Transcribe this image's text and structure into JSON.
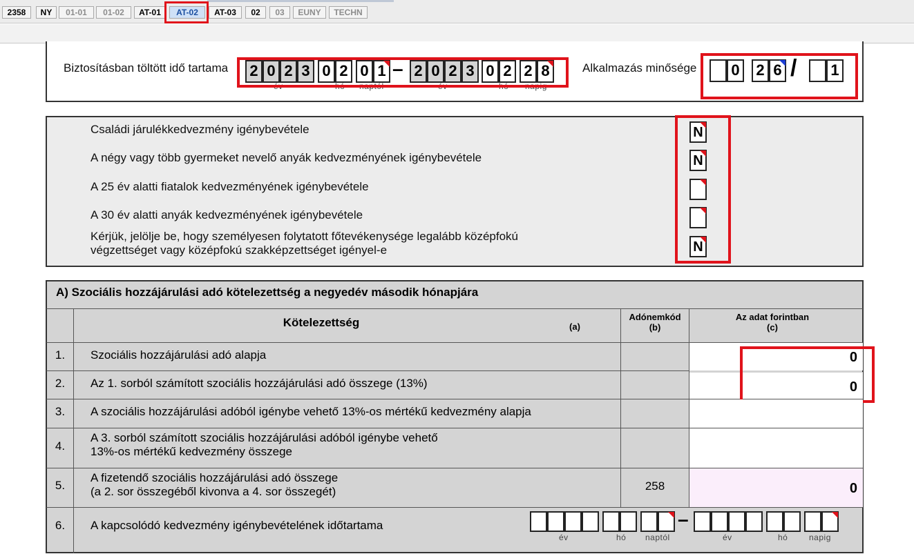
{
  "tabs": [
    {
      "label": "2358",
      "state": "normal"
    },
    {
      "label": "NY",
      "state": "normal"
    },
    {
      "label": "01-01",
      "state": "dim"
    },
    {
      "label": "01-02",
      "state": "dim"
    },
    {
      "label": "AT-01",
      "state": "normal"
    },
    {
      "label": "AT-02",
      "state": "active"
    },
    {
      "label": "AT-03",
      "state": "normal"
    },
    {
      "label": "02",
      "state": "normal"
    },
    {
      "label": "03",
      "state": "dim"
    },
    {
      "label": "EUNY",
      "state": "dim"
    },
    {
      "label": "TECHN",
      "state": "dim"
    }
  ],
  "insurance_period": {
    "label": "Biztosításban töltött idő tartama",
    "from": {
      "year": [
        "2",
        "0",
        "2",
        "3"
      ],
      "month": [
        "0",
        "2"
      ],
      "day": [
        "0",
        "1"
      ]
    },
    "to": {
      "year": [
        "2",
        "0",
        "2",
        "3"
      ],
      "month": [
        "0",
        "2"
      ],
      "day": [
        "2",
        "8"
      ]
    },
    "sublabels": {
      "year": "év",
      "month": "hó",
      "day_from": "naptól",
      "day_to": "napig"
    },
    "separator": "–"
  },
  "employment_quality": {
    "label": "Alkalmazás minősége",
    "digits_a": [
      "",
      "0"
    ],
    "digits_b": [
      "2",
      "6"
    ],
    "slash": "/",
    "digits_c": [
      "",
      "1"
    ]
  },
  "benefit_questions": [
    {
      "text": "Családi járulékkedvezmény igénybevétele",
      "value": "N"
    },
    {
      "text": "A négy vagy több gyermeket nevelő anyák kedvezményének igénybevétele",
      "value": "N"
    },
    {
      "text": "A 25 év alatti fiatalok kedvezményének igénybevétele",
      "value": ""
    },
    {
      "text": "A 30 év alatti anyák kedvezményének igénybevétele",
      "value": ""
    },
    {
      "text_line1": "Kérjük, jelölje be, hogy személyesen folytatott főtevékenysége legalább középfokú",
      "text_line2": "végzettséget vagy középfokú szakképzettséget igényel-e",
      "value": "N"
    }
  ],
  "section_a": {
    "title": "A) Szociális hozzájárulási adó kötelezettség a negyedév második hónapjára",
    "headers": {
      "obligation": "Kötelezettség",
      "col_a": "(a)",
      "tax_code": "Adónemkód",
      "col_b": "(b)",
      "amount": "Az adat forintban",
      "col_c": "(c)"
    },
    "rows": [
      {
        "num": "1.",
        "text": "Szociális hozzájárulási adó alapja",
        "code": "",
        "value": "0"
      },
      {
        "num": "2.",
        "text": "Az 1. sorból  számított szociális hozzájárulási adó összege (13%)",
        "code": "",
        "value": "0"
      },
      {
        "num": "3.",
        "text": "A szociális hozzájárulási adóból igénybe vehető 13%-os mértékű kedvezmény alapja",
        "code": "",
        "value": ""
      },
      {
        "num": "4.",
        "text_line1": "A 3. sorból  számított szociális hozzájárulási adóból igénybe vehető",
        "text_line2": "13%-os mértékű kedvezmény összege",
        "code": "",
        "value": ""
      },
      {
        "num": "5.",
        "text_line1": "A fizetendő szociális hozzájárulási adó összege",
        "text_line2": "(a 2. sor összegéből kivonva a 4. sor összegét)",
        "code": "258",
        "value": "0"
      },
      {
        "num": "6.",
        "text": "A kapcsolódó kedvezmény igénybevételének időtartama",
        "code": "",
        "value": ""
      }
    ],
    "row6_sublabels": {
      "year": "év",
      "month": "hó",
      "day_from": "naptól",
      "day_to": "napig"
    },
    "row6_separator": "–"
  }
}
